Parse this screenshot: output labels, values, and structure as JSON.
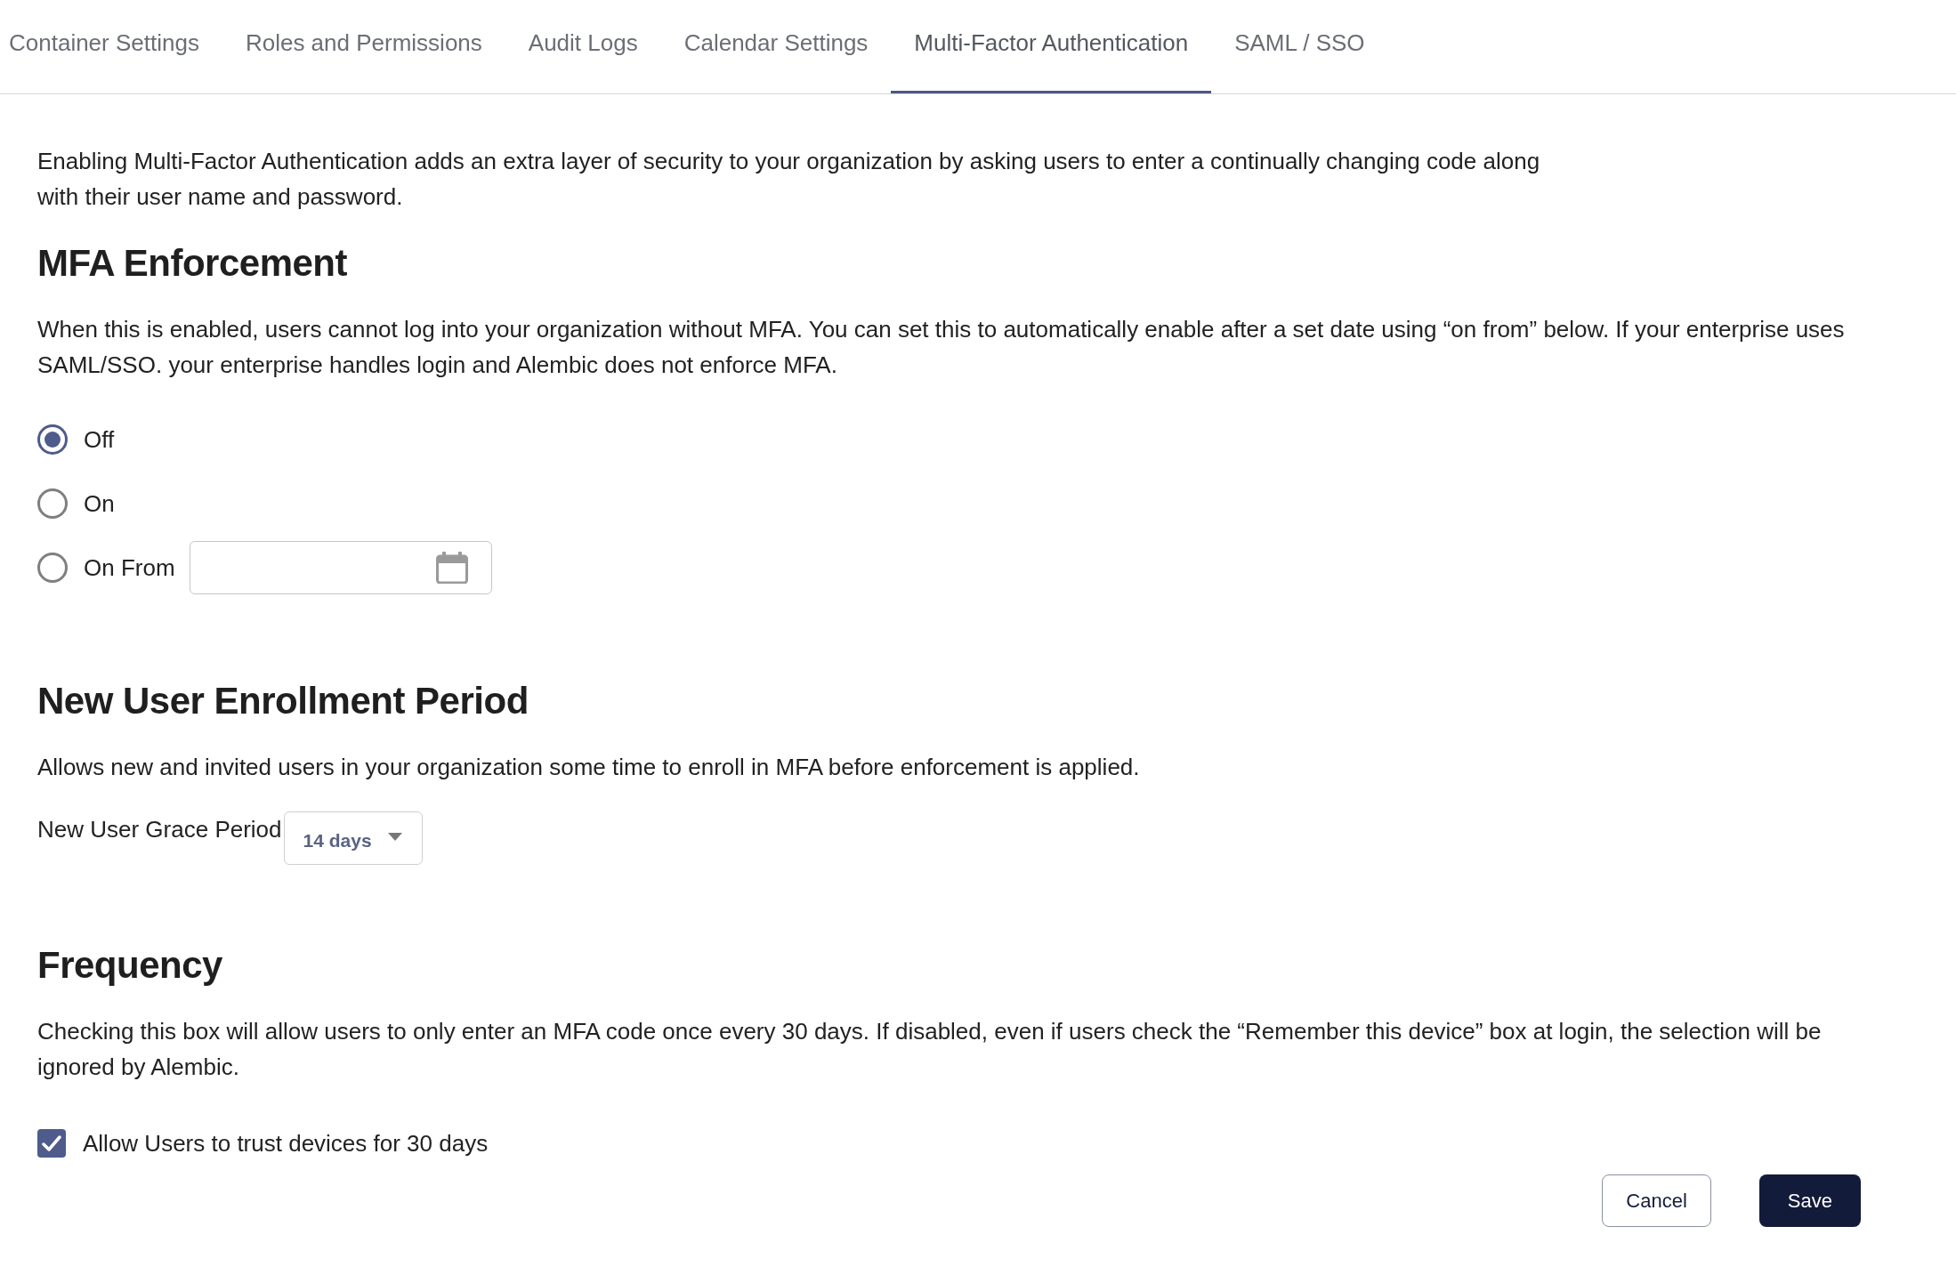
{
  "tabs": [
    {
      "label": "Container Settings",
      "selected": false
    },
    {
      "label": "Roles and Permissions",
      "selected": false
    },
    {
      "label": "Audit Logs",
      "selected": false
    },
    {
      "label": "Calendar Settings",
      "selected": false
    },
    {
      "label": "Multi-Factor Authentication",
      "selected": true
    },
    {
      "label": "SAML / SSO",
      "selected": false
    }
  ],
  "intro": "Enabling Multi-Factor Authentication adds an extra layer of security to your organization by asking users to enter a continually changing code along with their user name and password.",
  "mfa_enforcement": {
    "heading": "MFA Enforcement",
    "description": "When this is enabled, users cannot log into your organization without MFA. You can set this to automatically enable after a set date using “on from” below. If your enterprise uses SAML/SSO. your enterprise handles login and Alembic does not enforce MFA.",
    "options": [
      {
        "label": "Off",
        "selected": true,
        "kind": "plain"
      },
      {
        "label": "On",
        "selected": false,
        "kind": "plain"
      },
      {
        "label": "On From",
        "selected": false,
        "kind": "date"
      }
    ]
  },
  "new_user_enrollment_period": {
    "heading": "New User Enrollment Period",
    "description": "Allows new and invited users in your organization some time to enroll in MFA before enforcement is applied.",
    "grace_period": {
      "label": "New User Grace Period",
      "value": "14 days"
    }
  },
  "frequency": {
    "heading": "Frequency",
    "description": "Checking this box will allow users to only enter an MFA code once every 30 days. If disabled, even if users check the “Remember this device” box at login, the selection will be ignored by Alembic.",
    "trust_devices": {
      "label": "Allow Users to trust devices for 30 days",
      "checked": true
    }
  },
  "buttons": [
    {
      "label": "Cancel",
      "kind": "secondary"
    },
    {
      "label": "Save",
      "kind": "primary"
    }
  ]
}
